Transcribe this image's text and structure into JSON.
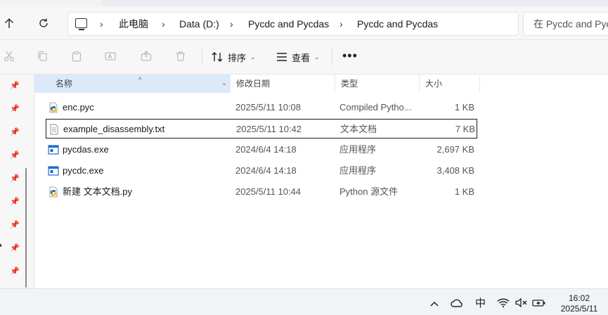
{
  "address_bar": {
    "crumbs": [
      "此电脑",
      "Data (D:)",
      "Pycdc and Pycdas",
      "Pycdc and Pycdas"
    ],
    "search_placeholder": "在 Pycdc and Pycdas"
  },
  "toolbar": {
    "sort_label": "排序",
    "view_label": "查看",
    "more_label": "•••"
  },
  "columns": {
    "name": "名称",
    "date": "修改日期",
    "type": "类型",
    "size": "大小"
  },
  "files": [
    {
      "name": "enc.pyc",
      "date": "2025/5/11 10:08",
      "type": "Compiled Pytho...",
      "size": "1 KB",
      "icon": "python-compiled-icon"
    },
    {
      "name": "example_disassembly.txt",
      "date": "2025/5/11 10:42",
      "type": "文本文档",
      "size": "7 KB",
      "icon": "text-file-icon"
    },
    {
      "name": "pycdas.exe",
      "date": "2024/6/4 14:18",
      "type": "应用程序",
      "size": "2,697 KB",
      "icon": "exe-icon"
    },
    {
      "name": "pycdc.exe",
      "date": "2024/6/4 14:18",
      "type": "应用程序",
      "size": "3,408 KB",
      "icon": "exe-icon"
    },
    {
      "name": "新建 文本文档.py",
      "date": "2025/5/11 10:44",
      "type": "Python 源文件",
      "size": "1 KB",
      "icon": "python-file-icon"
    }
  ],
  "taskbar": {
    "ime": "中",
    "time": "16:02",
    "date": "2025/5/11"
  },
  "colors": {
    "header_selected": "#dbe9f8",
    "exe_blue": "#1f6fd1",
    "python_blue": "#3572a5",
    "python_yellow": "#f2c230"
  }
}
